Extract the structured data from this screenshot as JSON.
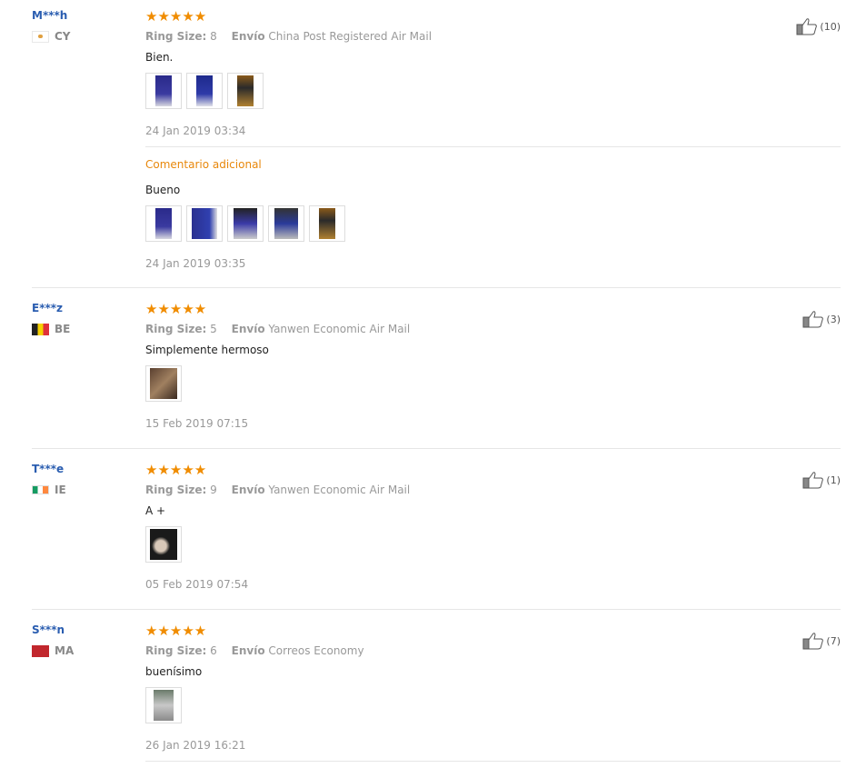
{
  "reviews": [
    {
      "user": "M***h",
      "country": "CY",
      "flag_colors": [
        "#ffffff",
        "#e0a040"
      ],
      "stars": "★★★★★",
      "ring_size_label": "Ring Size:",
      "ring_size": "8",
      "shipping_label": "Envío",
      "shipping": "China Post Registered Air Mail",
      "text": "Bien.",
      "images": [
        "phone-box-photo",
        "phone-box-photo",
        "product-photo"
      ],
      "date": "24 Jan 2019 03:34",
      "likes": "(10)",
      "additional": {
        "label": "Comentario adicional",
        "text": "Bueno",
        "images": [
          "phone-box-photo",
          "phone-box-photo",
          "screen-photo",
          "screen-photo",
          "product-photo"
        ],
        "date": "24 Jan 2019 03:35"
      }
    },
    {
      "user": "E***z",
      "country": "BE",
      "flag_colors": [
        "#222222",
        "#f5d000",
        "#e0303a"
      ],
      "stars": "★★★★★",
      "ring_size_label": "Ring Size:",
      "ring_size": "5",
      "shipping_label": "Envío",
      "shipping": "Yanwen Economic Air Mail",
      "text": "Simplemente hermoso",
      "images": [
        "hand-photo"
      ],
      "date": "15 Feb 2019 07:15",
      "likes": "(3)"
    },
    {
      "user": "T***e",
      "country": "IE",
      "flag_colors": [
        "#169b62",
        "#ffffff",
        "#ff883e"
      ],
      "stars": "★★★★★",
      "ring_size_label": "Ring Size:",
      "ring_size": "9",
      "shipping_label": "Envío",
      "shipping": "Yanwen Economic Air Mail",
      "text": "A +",
      "images": [
        "ring-photo"
      ],
      "date": "05 Feb 2019 07:54",
      "likes": "(1)"
    },
    {
      "user": "S***n",
      "country": "MA",
      "flag_colors": [
        "#c1272d"
      ],
      "stars": "★★★★★",
      "ring_size_label": "Ring Size:",
      "ring_size": "6",
      "shipping_label": "Envío",
      "shipping": "Correos Economy",
      "text": "buenísimo",
      "images": [
        "ring-photo"
      ],
      "date": "26 Jan 2019 16:21",
      "likes": "(7)"
    }
  ]
}
